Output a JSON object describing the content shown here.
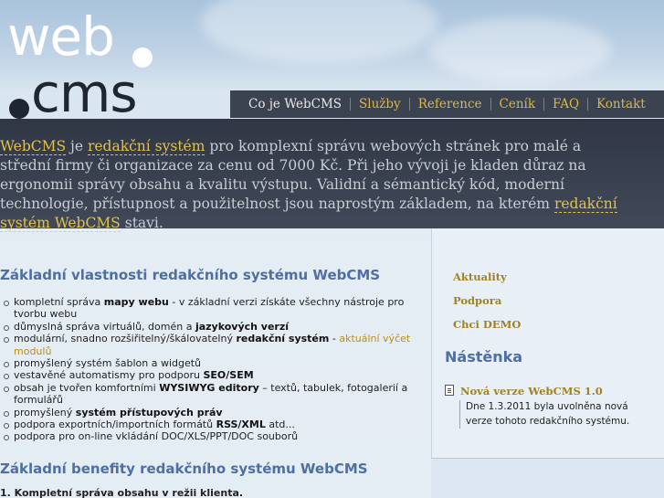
{
  "logo": {
    "line1": "web",
    "line2": "cms"
  },
  "nav": {
    "items": [
      "Co je WebCMS",
      "Služby",
      "Reference",
      "Ceník",
      "FAQ",
      "Kontakt"
    ]
  },
  "intro": {
    "link1": "WebCMS",
    "t1": " je ",
    "link2": "redakční systém",
    "t2": " pro komplexní správu webových stránek pro malé a střední firmy či organizace za cenu od 7000 Kč. Při jeho vývoji je kladen důraz na ergonomii správy obsahu a kvalitu výstupu. Validní a sémantický kód, moderní technologie, přístupnost a použitelnost jsou naprostým základem, na kterém ",
    "link3": "redakční systém WebCMS",
    "t3": " stavi."
  },
  "main": {
    "heading1": "Základní vlastnosti redakčního systému WebCMS",
    "features": [
      {
        "pre": "kompletní správa ",
        "bold": "mapy webu",
        "post": " - v základní verzi získáte všechny nástroje pro tvorbu webu"
      },
      {
        "pre": "důmyslná správa virtuálů, domén a ",
        "bold": "jazykových verzí",
        "post": ""
      },
      {
        "pre": "modulární, snadno rozšiřitelný/škálovatelný ",
        "bold": "redakční systém",
        "post": " - ",
        "link": "aktuální výčet modulů"
      },
      {
        "pre": "promyšlený systém šablon a widgetů",
        "bold": "",
        "post": ""
      },
      {
        "pre": "vestavěné automatismy pro podporu ",
        "bold": "SEO/SEM",
        "post": ""
      },
      {
        "pre": "obsah je tvořen komfortními ",
        "bold": "WYSIWYG editory",
        "post": " – textů, tabulek, fotogalerií a formulářů"
      },
      {
        "pre": "promyšlený ",
        "bold": "systém přístupových práv",
        "post": ""
      },
      {
        "pre": "podpora exportních/importních formátů ",
        "bold": "RSS/XML",
        "post": " atd..."
      },
      {
        "pre": "podpora pro on-line vkládání DOC/XLS/PPT/DOC souborů",
        "bold": "",
        "post": ""
      }
    ],
    "heading2": "Základní benefity redakčního systému WebCMS",
    "benefit1": "Kompletní správa obsahu v režii klienta."
  },
  "sidebar": {
    "links": [
      "Aktuality",
      "Podpora",
      "Chci DEMO"
    ],
    "board_heading": "Nástěnka",
    "news_title": "Nová verze WebCMS 1.0",
    "news_body": "Dne 1.3.2011 byla uvolněna nová verze tohoto redakčního systému."
  },
  "colors": {
    "accent_gold": "#e1c24d",
    "heading_blue": "#4e6fa3",
    "nav_bg": "#3b4250"
  }
}
